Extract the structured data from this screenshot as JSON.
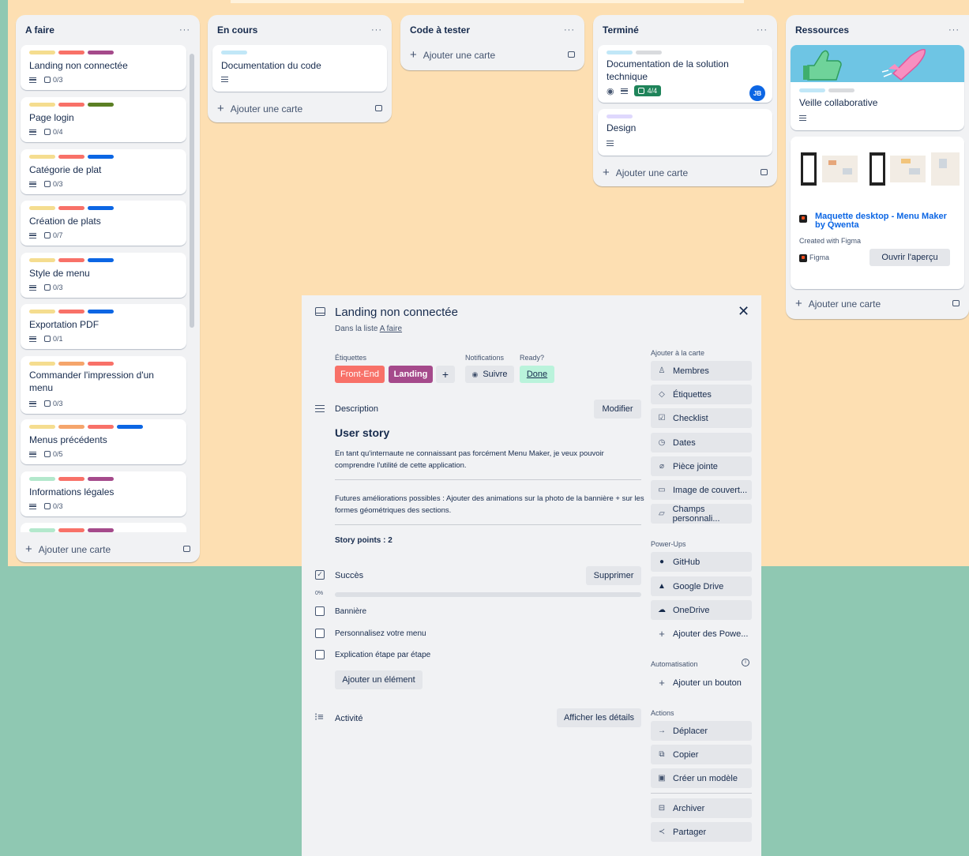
{
  "colors": {
    "yellow": "#f5dd8f",
    "red": "#f87168",
    "purple": "#a54a8b",
    "green_dark": "#5b7f24",
    "blue": "#0c66e4",
    "orange": "#f5a56b",
    "mint": "#b3e8cc",
    "sky": "#c1e7f7",
    "gray": "#d9dbde",
    "lavender": "#dfd8fd"
  },
  "lists": {
    "afaire": {
      "title": "A faire",
      "menu": "···",
      "cards": [
        {
          "title": "Landing non connectée",
          "check": "0/3"
        },
        {
          "title": "Page login",
          "check": "0/4"
        },
        {
          "title": "Catégorie de plat",
          "check": "0/3"
        },
        {
          "title": "Création de plats",
          "check": "0/7"
        },
        {
          "title": "Style de menu",
          "check": "0/3"
        },
        {
          "title": "Exportation PDF",
          "check": "0/1"
        },
        {
          "title": "Commander l'impression d'un menu",
          "check": "0/3"
        },
        {
          "title": "Menus précédents",
          "check": "0/5"
        },
        {
          "title": "Informations légales",
          "check": "0/3"
        }
      ],
      "add": "Ajouter une carte"
    },
    "encours": {
      "title": "En cours",
      "menu": "···",
      "cards": [
        {
          "title": "Documentation du code"
        }
      ],
      "add": "Ajouter une carte"
    },
    "codetester": {
      "title": "Code à tester",
      "menu": "···",
      "add": "Ajouter une carte"
    },
    "termine": {
      "title": "Terminé",
      "menu": "···",
      "cards": [
        {
          "title": "Documentation de la solution technique",
          "check": "4/4",
          "member": "JB"
        },
        {
          "title": "Design"
        }
      ],
      "add": "Ajouter une carte"
    },
    "ressources": {
      "title": "Ressources",
      "menu": "···",
      "cards": [
        {
          "title": "Veille collaborative"
        },
        {
          "link_title": "Maquette desktop - Menu Maker by Qwenta",
          "created": "Created with Figma",
          "source": "Figma",
          "preview": "Ouvrir l'aperçu"
        }
      ],
      "add": "Ajouter une carte"
    }
  },
  "modal": {
    "title": "Landing non connectée",
    "in_list_prefix": "Dans la liste",
    "in_list": "A faire",
    "labels_heading": "Étiquettes",
    "labels": [
      "Front-End",
      "Landing"
    ],
    "notif_heading": "Notifications",
    "follow": "Suivre",
    "ready_heading": "Ready?",
    "ready_value": "Done",
    "description_heading": "Description",
    "edit": "Modifier",
    "story_title": "User story",
    "story_text": "En tant qu'internaute ne connaissant pas forcément Menu Maker, je veux pouvoir comprendre l'utilité de cette application.",
    "future_text": "Futures améliorations possibles : Ajouter des animations sur la photo de la bannière + sur les formes géométriques des sections.",
    "story_points": "Story points : 2",
    "checklist_heading": "Succès",
    "delete": "Supprimer",
    "progress_label": "0%",
    "progress": 0,
    "items": [
      "Bannière",
      "Personnalisez votre menu",
      "Explication étape par étape"
    ],
    "add_item": "Ajouter un élément",
    "activity_heading": "Activité",
    "show_details": "Afficher les détails",
    "add_to_card": "Ajouter à la carte",
    "side": [
      "Membres",
      "Étiquettes",
      "Checklist",
      "Dates",
      "Pièce jointe",
      "Image de couvert...",
      "Champs personnali..."
    ],
    "powerups_heading": "Power-Ups",
    "powerups": [
      "GitHub",
      "Google Drive",
      "OneDrive"
    ],
    "add_powerups": "Ajouter des Powe...",
    "automation_heading": "Automatisation",
    "add_button": "Ajouter un bouton",
    "actions_heading": "Actions",
    "actions": [
      "Déplacer",
      "Copier",
      "Créer un modèle",
      "Archiver",
      "Partager"
    ]
  }
}
